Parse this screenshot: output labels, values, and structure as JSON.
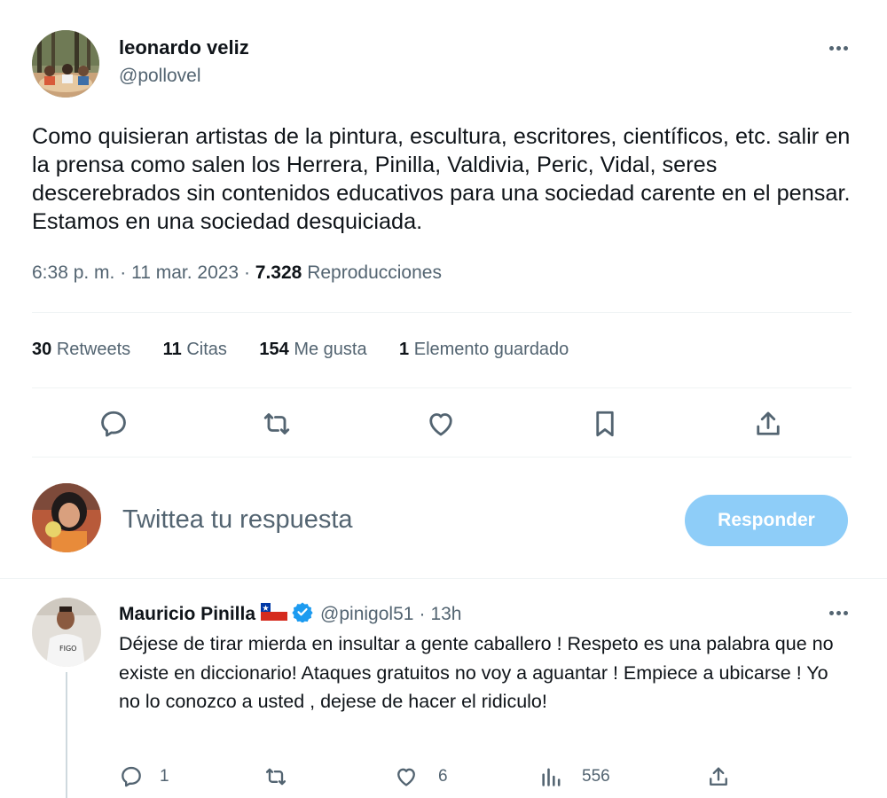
{
  "tweet": {
    "author_name": "leonardo veliz",
    "author_handle": "@pollovel",
    "text": "Como quisieran artistas de la pintura, escultura, escritores, científicos, etc. salir en la prensa como salen los Herrera, Pinilla, Valdivia, Peric, Vidal, seres descerebrados sin contenidos educativos para una sociedad carente en el pensar. Estamos en una sociedad desquiciada.",
    "time": "6:38 p. m.",
    "date": "11 mar. 2023",
    "views_count": "7.328",
    "views_label": "Reproducciones",
    "dot": "·"
  },
  "stats": {
    "retweets_count": "30",
    "retweets_label": "Retweets",
    "quotes_count": "11",
    "quotes_label": "Citas",
    "likes_count": "154",
    "likes_label": "Me gusta",
    "bookmarks_count": "1",
    "bookmarks_label": "Elemento guardado"
  },
  "reply_box": {
    "placeholder": "Twittea tu respuesta",
    "button_label": "Responder"
  },
  "reply": {
    "author_name": "Mauricio Pinilla",
    "author_handle": "@pinigol51",
    "time_ago": "13h",
    "dot": "·",
    "text": "Déjese de tirar mierda en insultar a gente caballero ! Respeto es una palabra que no existe en diccionario! Ataques gratuitos no voy a aguantar ! Empiece a ubicarse ! Yo no lo conozco a usted , dejese de hacer el ridiculo!",
    "reply_count": "1",
    "like_count": "6",
    "views_count": "556"
  },
  "colors": {
    "accent": "#1d9bf0",
    "button_disabled": "#8ecdf8",
    "muted": "#536471",
    "divider": "#eff3f4",
    "verified": "#1d9bf0",
    "flag_red": "#d52b1e",
    "flag_blue": "#0039a6"
  },
  "icons": [
    "more-icon",
    "reply-icon",
    "retweet-icon",
    "like-icon",
    "bookmark-icon",
    "share-icon",
    "verified-icon",
    "chile-flag-icon",
    "views-icon"
  ]
}
